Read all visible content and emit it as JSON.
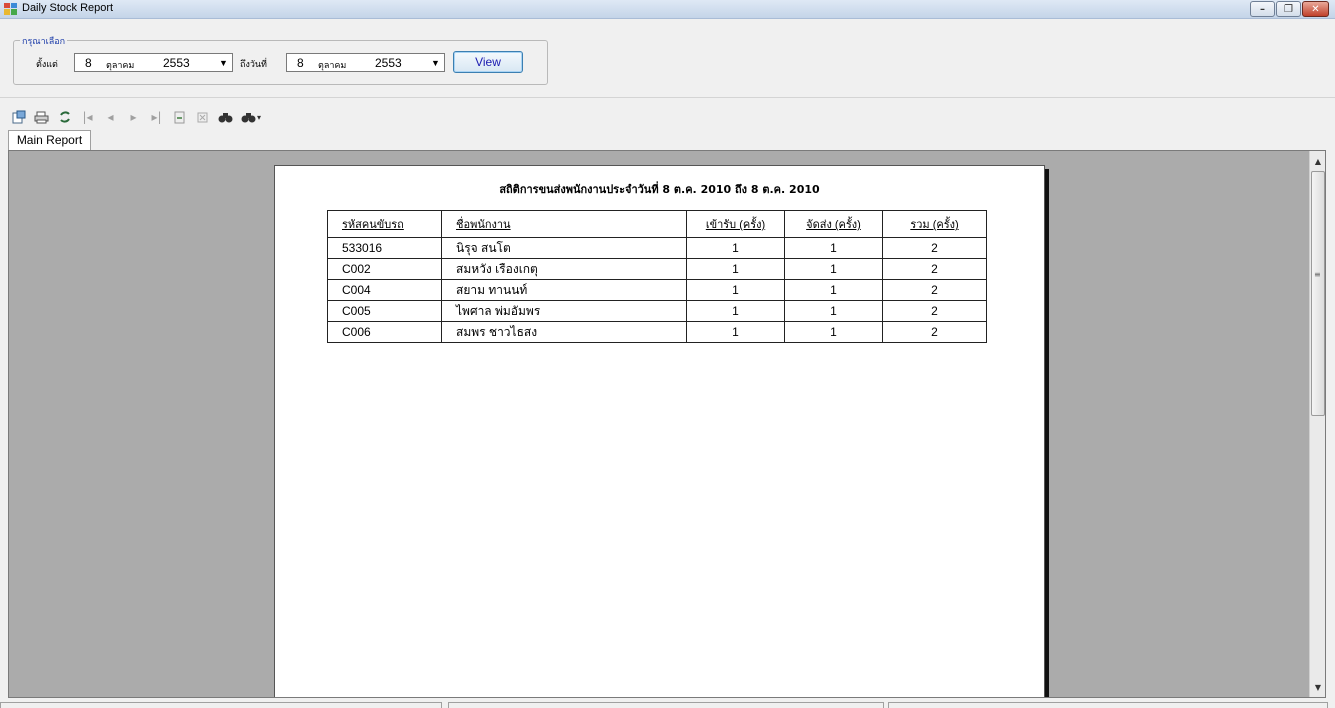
{
  "window": {
    "title": "Daily Stock Report"
  },
  "filter": {
    "group_label": "กรุณาเลือก",
    "from_label": "ตั้งแต่",
    "to_label": "ถึงวันที่",
    "from_date": {
      "day": "8",
      "month": "ตุลาคม",
      "year": "2553"
    },
    "to_date": {
      "day": "8",
      "month": "ตุลาคม",
      "year": "2553"
    },
    "view_button": "View"
  },
  "toolbar": {
    "icons": [
      "export-icon",
      "print-icon",
      "refresh-icon",
      "first-page-icon",
      "prev-page-icon",
      "next-page-icon",
      "last-page-icon",
      "goto-page-icon",
      "close-view-icon",
      "find-icon",
      "zoom-icon"
    ]
  },
  "tabs": [
    {
      "label": "Main Report"
    }
  ],
  "report": {
    "title": "สถิติการขนส่งพนักงานประจำวันที่ 8 ต.ค. 2010 ถึง 8 ต.ค. 2010",
    "columns": [
      "รหัสคนขับรถ",
      "ชื่อพนักงาน",
      "เข้ารับ (ครั้ง)",
      "จัดส่ง (ครั้ง)",
      "รวม (ครั้ง)"
    ],
    "rows": [
      [
        "533016",
        "นิรุจ สนโต",
        "1",
        "1",
        "2"
      ],
      [
        "C002",
        "สมหวัง เรืองเกตุ",
        "1",
        "1",
        "2"
      ],
      [
        "C004",
        "สยาม ทานนท์",
        "1",
        "1",
        "2"
      ],
      [
        "C005",
        "ไพศาล พ่มอัมพร",
        "1",
        "1",
        "2"
      ],
      [
        "C006",
        "สมพร ชาวไธสง",
        "1",
        "1",
        "2"
      ]
    ]
  }
}
